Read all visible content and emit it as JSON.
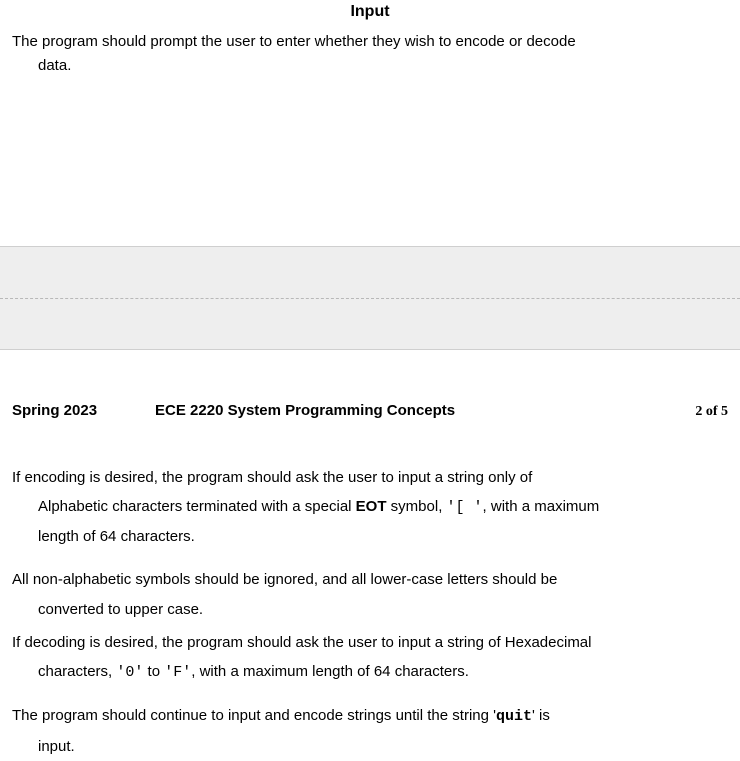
{
  "page1": {
    "heading": "Input",
    "body_line1": "The program should prompt the user to enter whether they wish to encode or decode",
    "body_line2": "data."
  },
  "page2": {
    "header": {
      "term": "Spring 2023",
      "course": "ECE 2220 System Programming Concepts",
      "page_num": "2 of 5"
    },
    "p1": {
      "a": "If encoding is desired, the program should ask the user to input a string only of",
      "b1": "Alphabetic characters terminated with a special ",
      "eot": "EOT",
      "b2": " symbol, ",
      "sym": "'[ '",
      "b3": ", with a maximum",
      "c": "length of 64 characters."
    },
    "p2": {
      "a": "All non-alphabetic symbols should be ignored, and all lower-case letters should be",
      "b": "converted to upper case."
    },
    "p3": {
      "a": "If decoding is desired, the program should ask the user to input a string of Hexadecimal",
      "b1": "characters, ",
      "r1": "'0'",
      "b2": " to ",
      "r2": "'F'",
      "b3": ", with a maximum length of 64 characters."
    },
    "p4": {
      "a1": "The program should continue to input and encode strings until the string '",
      "quit": "quit",
      "a2": "' is",
      "b": "input."
    }
  }
}
